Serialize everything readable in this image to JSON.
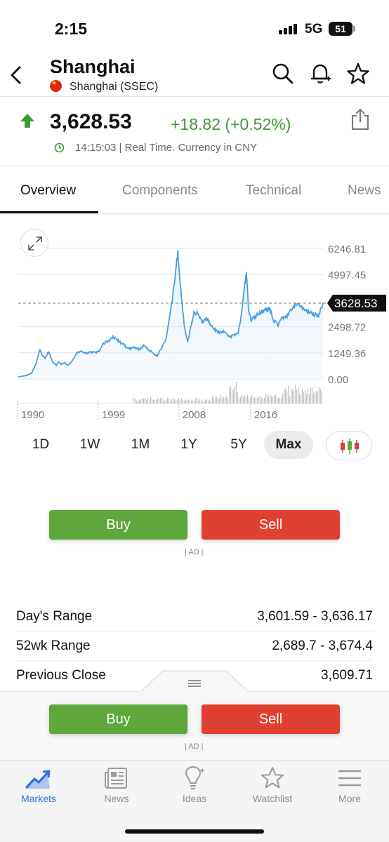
{
  "status_bar": {
    "time": "2:15",
    "network": "5G",
    "battery": "51"
  },
  "header": {
    "title": "Shanghai",
    "subtitle": "Shanghai (SSEC)"
  },
  "quote": {
    "price": "3,628.53",
    "change": "+18.82 (+0.52%)",
    "timestamp": "14:15:03 | Real Time. Currency in CNY",
    "up_color": "#3d9a33"
  },
  "tabs": [
    "Overview",
    "Components",
    "Technical",
    "News"
  ],
  "chart_data": {
    "type": "line",
    "y_ticks": [
      "6246.81",
      "4997.45",
      "2498.72",
      "1249.36",
      "0.00"
    ],
    "x_ticks": [
      "1990",
      "1999",
      "2008",
      "2016"
    ],
    "current_label": "3628.53",
    "ylim": [
      0,
      6246.81
    ],
    "line_color": "#4a9fe0",
    "x": [
      1990.0,
      1990.5,
      1991.0,
      1991.5,
      1992.0,
      1992.4,
      1992.7,
      1993.0,
      1993.4,
      1993.8,
      1994.2,
      1994.5,
      1994.8,
      1995.2,
      1995.6,
      1996.0,
      1996.5,
      1997.0,
      1997.5,
      1998.0,
      1998.5,
      1999.0,
      1999.5,
      2000.0,
      2000.5,
      2001.0,
      2001.5,
      2002.0,
      2002.5,
      2003.0,
      2003.5,
      2004.0,
      2004.5,
      2005.0,
      2005.5,
      2006.0,
      2006.5,
      2007.0,
      2007.4,
      2007.8,
      2008.2,
      2008.6,
      2008.9,
      2009.3,
      2009.6,
      2010.0,
      2010.5,
      2011.0,
      2011.5,
      2012.0,
      2012.5,
      2013.0,
      2013.5,
      2014.0,
      2014.5,
      2014.9,
      2015.2,
      2015.45,
      2015.7,
      2016.0,
      2016.5,
      2017.0,
      2017.5,
      2018.0,
      2018.5,
      2019.0,
      2019.5,
      2020.0,
      2020.5,
      2021.0,
      2021.5,
      2022.0,
      2022.5,
      2023.0,
      2023.5,
      2024.0
    ],
    "y": [
      100,
      130,
      180,
      290,
      760,
      1400,
      1100,
      1000,
      1300,
      850,
      650,
      800,
      700,
      760,
      650,
      860,
      1200,
      1350,
      1200,
      1300,
      1250,
      1300,
      1700,
      1800,
      2000,
      1900,
      1700,
      1550,
      1450,
      1500,
      1400,
      1600,
      1400,
      1250,
      1100,
      1500,
      1900,
      3200,
      4500,
      6050,
      3900,
      2300,
      1800,
      2600,
      3200,
      3100,
      2700,
      2900,
      2600,
      2300,
      2200,
      2300,
      2000,
      2100,
      2200,
      3000,
      4300,
      5150,
      3300,
      2800,
      3000,
      3200,
      3250,
      3400,
      2800,
      2600,
      2950,
      3000,
      3300,
      3550,
      3500,
      3300,
      3200,
      3100,
      3000,
      3628.53
    ]
  },
  "ranges": [
    "1D",
    "1W",
    "1M",
    "1Y",
    "5Y",
    "Max"
  ],
  "active_range": "Max",
  "actions": {
    "buy": "Buy",
    "sell": "Sell",
    "ad": "| AD |"
  },
  "stats": [
    {
      "label": "Day's Range",
      "value": "3,601.59 - 3,636.17"
    },
    {
      "label": "52wk Range",
      "value": "2,689.7 - 3,674.4"
    },
    {
      "label": "Previous Close",
      "value": "3,609.71"
    }
  ],
  "bottom_nav": [
    "Markets",
    "News",
    "Ideas",
    "Watchlist",
    "More"
  ],
  "accent": "#2f6ee0",
  "buy_color": "#5ea73a",
  "sell_color": "#e0402f"
}
